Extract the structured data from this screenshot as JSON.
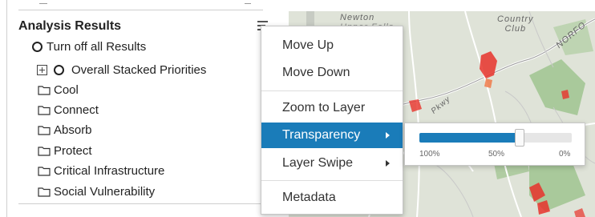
{
  "panel": {
    "title": "Analysis Results",
    "items": [
      {
        "label": "Turn off all Results",
        "icon": "radio-icon"
      },
      {
        "label": "Overall Stacked Priorities",
        "icon": "radio-icon",
        "expand_icon": "expand-plus-icon"
      },
      {
        "label": "Cool",
        "icon": "folder-icon"
      },
      {
        "label": "Connect",
        "icon": "folder-icon"
      },
      {
        "label": "Absorb",
        "icon": "folder-icon"
      },
      {
        "label": "Protect",
        "icon": "folder-icon"
      },
      {
        "label": "Critical Infrastructure",
        "icon": "folder-icon"
      },
      {
        "label": "Social Vulnerability",
        "icon": "folder-icon"
      }
    ]
  },
  "context_menu": {
    "items": [
      {
        "label": "Move Up"
      },
      {
        "label": "Move Down"
      },
      {
        "label": "Zoom to Layer"
      },
      {
        "label": "Transparency",
        "submenu": true,
        "active": true
      },
      {
        "label": "Layer Swipe",
        "submenu": true
      },
      {
        "label": "Metadata"
      }
    ]
  },
  "transparency": {
    "value_percent": 66,
    "labels": [
      "100%",
      "50%",
      "0%"
    ]
  },
  "map": {
    "labels": {
      "newton": "Newton",
      "newton_faded": "Upper Falls",
      "country": "Country",
      "club": "Club",
      "norfolk": "NORFO",
      "pkwy": "Pkwy"
    }
  },
  "colors": {
    "accent": "#1a7cb9",
    "map_background": "#dfe3d8",
    "map_hotspot": "#e8322b",
    "map_green": "#9bc28c"
  }
}
